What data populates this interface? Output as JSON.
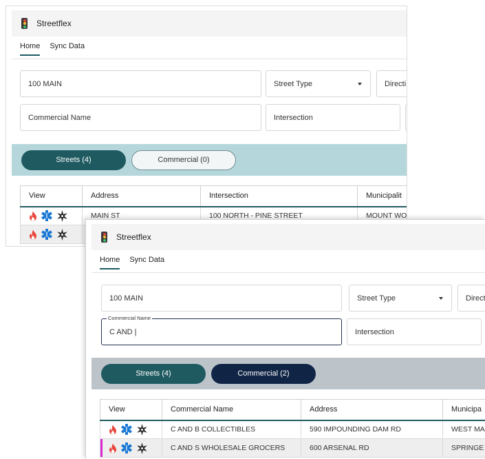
{
  "app": {
    "title": "Streetflex"
  },
  "tabs": [
    "Home",
    "Sync Data"
  ],
  "colors": {
    "primary": "#1f5a61",
    "navy": "#102445",
    "fire": "#e8453c",
    "ems": "#1a78d4",
    "police": "#222222",
    "highlight": "#d62ad0"
  },
  "icons": [
    "traffic-light-icon",
    "fire-icon",
    "ems-star-icon",
    "police-badge-icon",
    "chevron-down-icon"
  ],
  "back": {
    "search": {
      "street_value": "100 MAIN",
      "street_type_placeholder": "Street Type",
      "direction_placeholder": "Directi",
      "commercial_placeholder": "Commercial Name",
      "intersection_placeholder": "Intersection"
    },
    "toggles": {
      "streets": "Streets (4)",
      "commercial": "Commercial (0)"
    },
    "table": {
      "columns": [
        "View",
        "Address",
        "Intersection",
        "Municipalit"
      ],
      "rows": [
        {
          "address": "MAIN ST",
          "intersection": "100 NORTH - PINE STREET",
          "municipality": "MOUNT WO"
        },
        {
          "address": "",
          "intersection": "",
          "municipality": ""
        }
      ]
    }
  },
  "front": {
    "search": {
      "street_value": "100 MAIN",
      "street_type_placeholder": "Street Type",
      "direction_placeholder": "Directi",
      "commercial_label": "Commercial Name",
      "commercial_value": "C AND |",
      "intersection_placeholder": "Intersection"
    },
    "toggles": {
      "streets": "Streets (4)",
      "commercial": "Commercial (2)"
    },
    "table": {
      "columns": [
        "View",
        "Commercial Name",
        "Address",
        "Municipa"
      ],
      "rows": [
        {
          "name": "C AND B COLLECTIBLES",
          "address": "590 IMPOUNDING DAM RD",
          "municipality": "WEST MA"
        },
        {
          "name": "C AND S WHOLESALE GROCERS",
          "address": "600 ARSENAL RD",
          "municipality": "SPRINGE"
        }
      ]
    }
  }
}
